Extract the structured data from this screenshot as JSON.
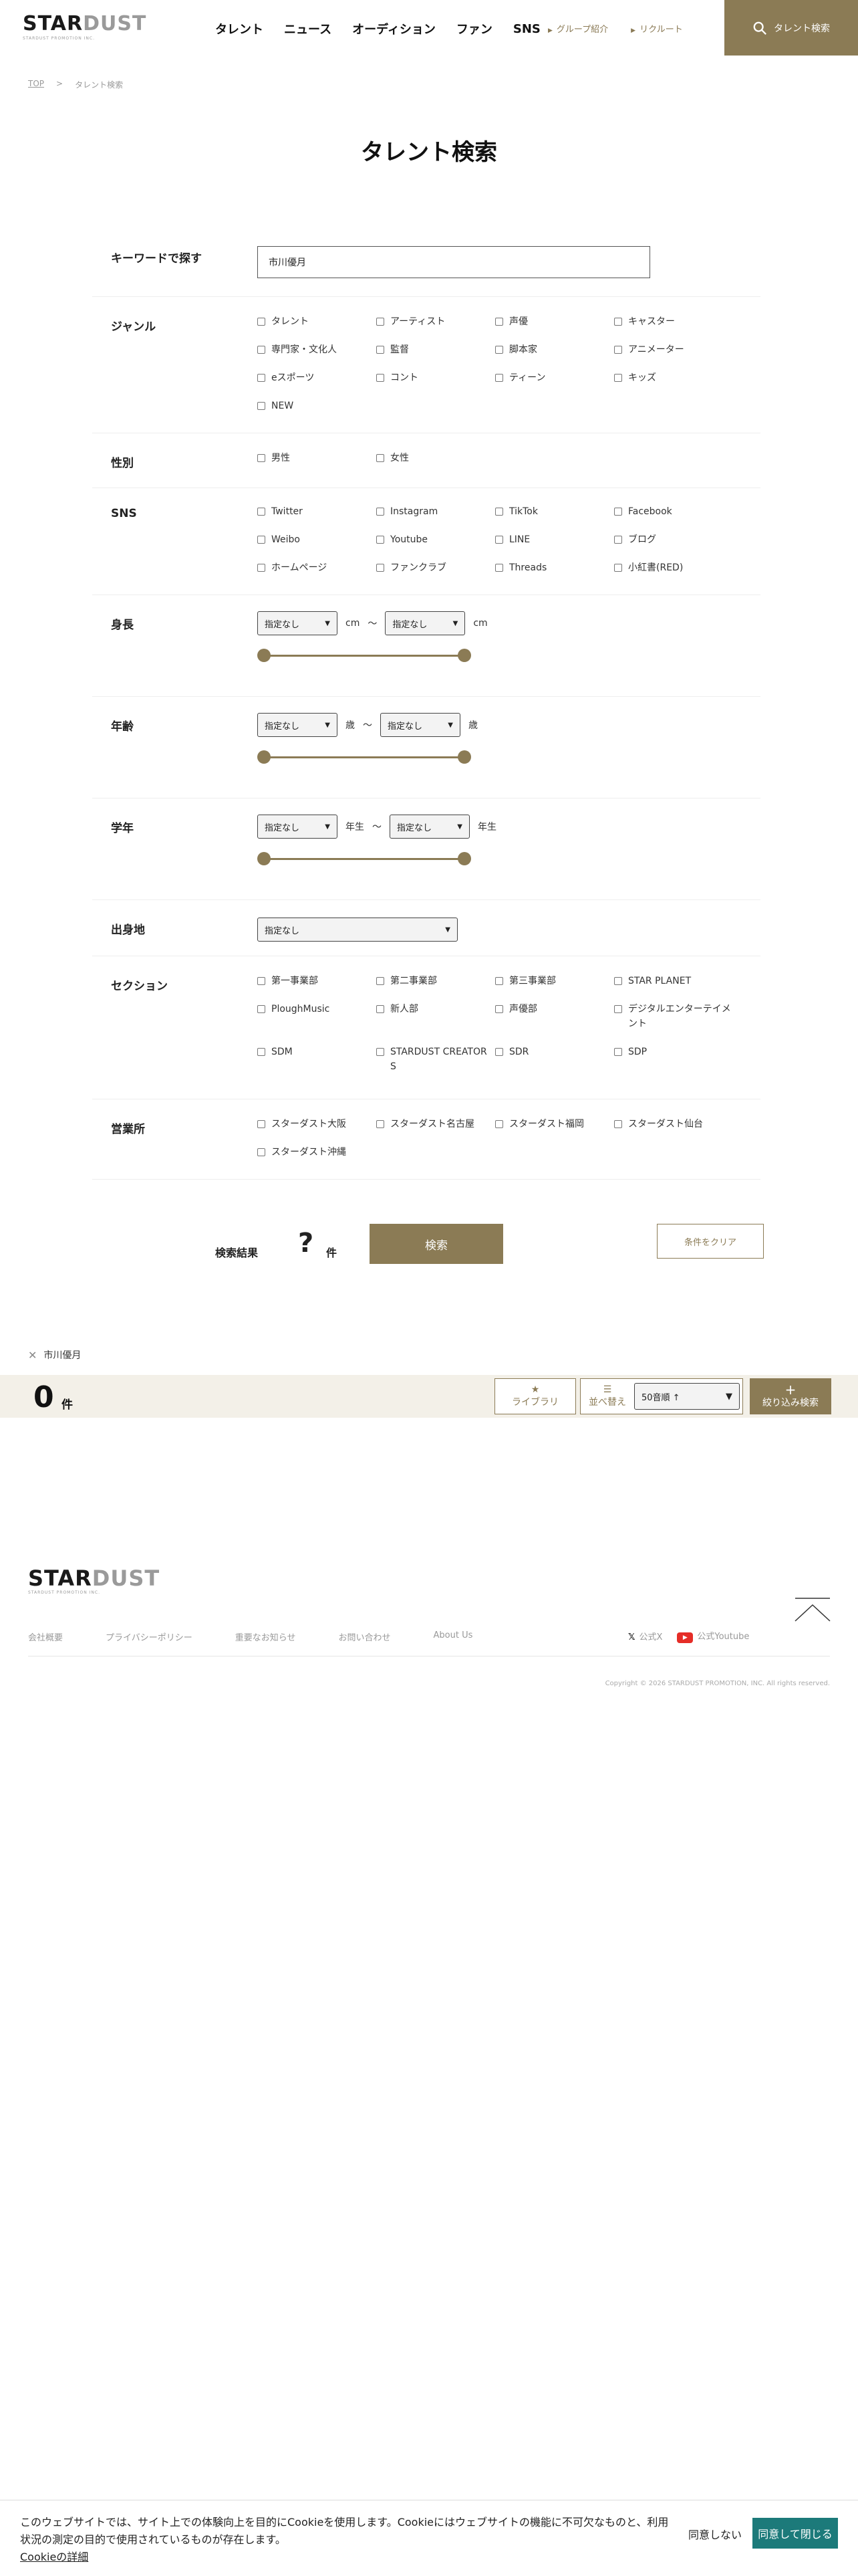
{
  "header": {
    "logo_main": "STAR",
    "logo_accent": "DUST",
    "logo_sub": "STARDUST PROMOTION INC.",
    "nav": [
      "タレント",
      "ニュース",
      "オーディション",
      "ファン",
      "SNS"
    ],
    "sub_nav": [
      "グループ紹介",
      "リクルート"
    ],
    "search_button": "タレント検索"
  },
  "breadcrumb": {
    "home": "TOP",
    "sep": ">",
    "current": "タレント検索"
  },
  "page_title": "タレント検索",
  "form": {
    "keyword": {
      "label": "キーワードで探す",
      "value": "市川優月"
    },
    "genre": {
      "label": "ジャンル",
      "options": [
        "タレント",
        "アーティスト",
        "声優",
        "キャスター",
        "専門家・文化人",
        "監督",
        "脚本家",
        "アニメーター",
        "eスポーツ",
        "コント",
        "ティーン",
        "キッズ",
        "NEW"
      ]
    },
    "gender": {
      "label": "性別",
      "options": [
        "男性",
        "女性"
      ]
    },
    "sns": {
      "label": "SNS",
      "options": [
        "Twitter",
        "Instagram",
        "TikTok",
        "Facebook",
        "Weibo",
        "Youtube",
        "LINE",
        "ブログ",
        "ホームページ",
        "ファンクラブ",
        "Threads",
        "小紅書(RED)"
      ]
    },
    "height": {
      "label": "身長",
      "min": "指定なし",
      "max": "指定なし",
      "unit": "cm",
      "tilde": "〜"
    },
    "age": {
      "label": "年齢",
      "min": "指定なし",
      "max": "指定なし",
      "unit": "歳",
      "tilde": "〜"
    },
    "grade": {
      "label": "学年",
      "min": "指定なし",
      "max": "指定なし",
      "unit": "年生",
      "tilde": "〜"
    },
    "hometown": {
      "label": "出身地",
      "value": "指定なし"
    },
    "section": {
      "label": "セクション",
      "options": [
        "第一事業部",
        "第二事業部",
        "第三事業部",
        "STAR PLANET",
        "PloughMusic",
        "新人部",
        "声優部",
        "デジタルエンターテイメント",
        "SDM",
        "STARDUST CREATORS",
        "SDR",
        "SDP"
      ]
    },
    "office": {
      "label": "営業所",
      "options": [
        "スターダスト大阪",
        "スターダスト名古屋",
        "スターダスト福岡",
        "スターダスト仙台",
        "スターダスト沖縄"
      ]
    }
  },
  "result": {
    "label": "検索結果",
    "count": "?",
    "unit": "件",
    "search_button": "検索",
    "clear_button": "条件をクリア"
  },
  "active_filter": "市川優月",
  "count_bar": {
    "count": "0",
    "unit": "件",
    "library": "ライブラリ",
    "sort": "並べ替え",
    "sort_value": "50音順 ↑",
    "narrow": "絞り込み検索"
  },
  "footer": {
    "logo_main": "STAR",
    "logo_accent": "DUST",
    "logo_sub": "STARDUST PROMOTION INC.",
    "links": [
      "会社概要",
      "プライバシーポリシー",
      "重要なお知らせ",
      "お問い合わせ",
      "About Us"
    ],
    "social": [
      "公式X",
      "公式Youtube"
    ],
    "copyright": "Copyright © 2026 STARDUST PROMOTION, INC. All rights reserved."
  },
  "cookie": {
    "text": "このウェブサイトでは、サイト上での体験向上を目的にCookieを使用します。Cookieにはウェブサイトの機能に不可欠なものと、利用状況の測定の目的で使用されているものが存在します。",
    "link": "Cookieの詳細",
    "decline": "同意しない",
    "accept": "同意して閉じる"
  },
  "colors": {
    "accent": "#8b7b55",
    "cookie_accept": "#1c7a7a",
    "count_bar_bg": "#f3f0e8"
  }
}
